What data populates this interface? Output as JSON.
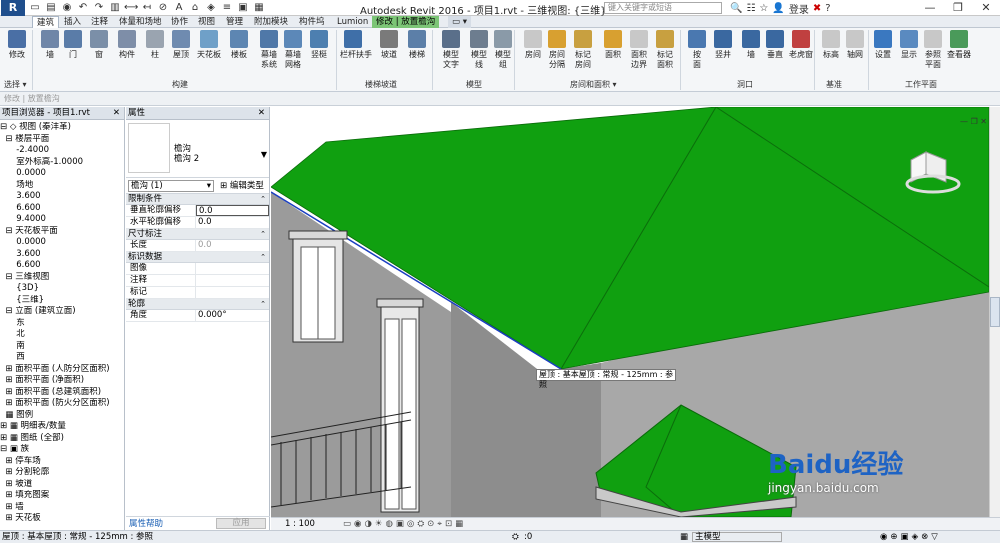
{
  "titlebar": {
    "app_button": "R",
    "window_title": "Autodesk Revit 2016 -   项目1.rvt - 三维视图: {三维}",
    "search_placeholder": "键入关键字或短语",
    "login": "登录",
    "help": "?"
  },
  "tabs": [
    {
      "label": "建筑"
    },
    {
      "label": "插入"
    },
    {
      "label": "注释"
    },
    {
      "label": "体量和场地"
    },
    {
      "label": "协作"
    },
    {
      "label": "视图"
    },
    {
      "label": "管理"
    },
    {
      "label": "附加模块"
    },
    {
      "label": "构件坞"
    },
    {
      "label": "Lumion"
    },
    {
      "label": "修改 | 放置檐沟"
    }
  ],
  "ribbon": {
    "buttons": [
      {
        "label": "修改"
      },
      {
        "label": "墙"
      },
      {
        "label": "门"
      },
      {
        "label": "窗"
      },
      {
        "label": "构件"
      },
      {
        "label": "柱"
      },
      {
        "label": "屋顶"
      },
      {
        "label": "天花板"
      },
      {
        "label": "楼板"
      },
      {
        "label": "幕墙\n系统"
      },
      {
        "label": "幕墙\n网格"
      },
      {
        "label": "竖梃"
      },
      {
        "label": "栏杆扶手"
      },
      {
        "label": "坡道"
      },
      {
        "label": "楼梯"
      },
      {
        "label": "模型\n文字"
      },
      {
        "label": "模型\n线"
      },
      {
        "label": "模型\n组"
      },
      {
        "label": "房间"
      },
      {
        "label": "房间\n分隔"
      },
      {
        "label": "标记\n房间"
      },
      {
        "label": "面积"
      },
      {
        "label": "面积\n边界"
      },
      {
        "label": "标记\n面积"
      },
      {
        "label": "按\n面"
      },
      {
        "label": "竖井"
      },
      {
        "label": "墙"
      },
      {
        "label": "垂直"
      },
      {
        "label": "老虎窗"
      },
      {
        "label": "标高"
      },
      {
        "label": "轴网"
      },
      {
        "label": "设置"
      },
      {
        "label": "显示"
      },
      {
        "label": "参照\n平面"
      },
      {
        "label": "查看器"
      }
    ],
    "panels": [
      {
        "label": "选择 ▾"
      },
      {
        "label": "构建"
      },
      {
        "label": "楼梯坡道"
      },
      {
        "label": "模型"
      },
      {
        "label": "房间和面积 ▾"
      },
      {
        "label": "洞口"
      },
      {
        "label": "基准"
      },
      {
        "label": "工作平面"
      }
    ]
  },
  "options_bar": {
    "text": "修改 | 放置檐沟"
  },
  "project_browser": {
    "title": "项目浏览器 - 项目1.rvt",
    "nodes": [
      {
        "label": "⊟ ◇ 视图 (秦沣革)"
      },
      {
        "label": "  ⊟ 楼层平面"
      },
      {
        "label": "      -2.4000"
      },
      {
        "label": "      室外标高-1.0000"
      },
      {
        "label": "      0.0000"
      },
      {
        "label": "      场地"
      },
      {
        "label": "      3.600"
      },
      {
        "label": "      6.600"
      },
      {
        "label": "      9.4000"
      },
      {
        "label": "  ⊟ 天花板平面"
      },
      {
        "label": "      0.0000"
      },
      {
        "label": "      3.600"
      },
      {
        "label": "      6.600"
      },
      {
        "label": "  ⊟ 三维视图"
      },
      {
        "label": "      {3D}"
      },
      {
        "label": "      {三维}"
      },
      {
        "label": "  ⊟ 立面 (建筑立面)"
      },
      {
        "label": "      东"
      },
      {
        "label": "      北"
      },
      {
        "label": "      南"
      },
      {
        "label": "      西"
      },
      {
        "label": "  ⊞ 面积平面 (人防分区面积)"
      },
      {
        "label": "  ⊞ 面积平面 (净面积)"
      },
      {
        "label": "  ⊞ 面积平面 (总建筑面积)"
      },
      {
        "label": "  ⊞ 面积平面 (防火分区面积)"
      },
      {
        "label": "  ▦ 图例"
      },
      {
        "label": "⊞ ▦ 明细表/数量"
      },
      {
        "label": "⊞ ▦ 图纸 (全部)"
      },
      {
        "label": "⊟ ▣ 族"
      },
      {
        "label": "  ⊞ 停车场"
      },
      {
        "label": "  ⊞ 分割轮廓"
      },
      {
        "label": "  ⊞ 坡道"
      },
      {
        "label": "  ⊞ 填充图案"
      },
      {
        "label": "  ⊞ 墙"
      },
      {
        "label": "  ⊞ 天花板"
      }
    ]
  },
  "properties": {
    "title": "属性",
    "type_family": "檐沟",
    "type_name": "檐沟 2",
    "instance_selector": "檐沟 (1)",
    "edit_type": "编辑类型",
    "sections": [
      {
        "name": "限制条件",
        "rows": [
          {
            "k": "垂直轮廓偏移",
            "v": "0.0"
          },
          {
            "k": "水平轮廓偏移",
            "v": "0.0"
          }
        ]
      },
      {
        "name": "尺寸标注",
        "rows": [
          {
            "k": "长度",
            "v": "0.0"
          }
        ]
      },
      {
        "name": "标识数据",
        "rows": [
          {
            "k": "图像",
            "v": ""
          },
          {
            "k": "注释",
            "v": ""
          },
          {
            "k": "标记",
            "v": ""
          }
        ]
      },
      {
        "name": "轮廓",
        "rows": [
          {
            "k": "角度",
            "v": "0.000°"
          }
        ]
      }
    ],
    "help_link": "属性帮助",
    "apply_button": "应用"
  },
  "viewport": {
    "tooltip": "屋顶 : 基本屋顶 : 常规 - 125mm : 参照",
    "scale": "1 : 100",
    "watermark": "Baidu经验",
    "watermark_url": "jingyan.baidu.com"
  },
  "statusbar": {
    "text": "屋顶 : 基本屋顶 : 常规 - 125mm : 参照",
    "model": "主模型",
    "count": ":0"
  },
  "colors": {
    "roof_green": "#10a010",
    "ribbon_bg": "#f4f6f8",
    "context_tab": "#7cc576"
  }
}
